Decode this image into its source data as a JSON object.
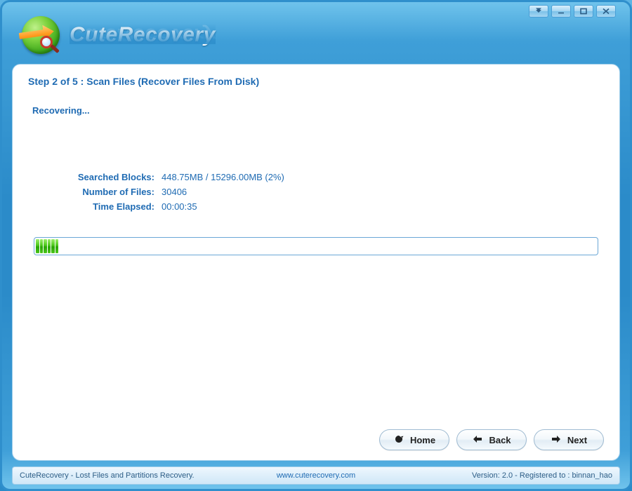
{
  "app": {
    "title": "CuteRecovery"
  },
  "step": {
    "heading": "Step 2 of 5 : Scan Files (Recover Files From Disk)",
    "status": "Recovering..."
  },
  "stats": {
    "searched_blocks_label": "Searched Blocks:",
    "searched_blocks_value": "448.75MB / 15296.00MB (2%)",
    "number_of_files_label": "Number of Files:",
    "number_of_files_value": "30406",
    "time_elapsed_label": "Time Elapsed:",
    "time_elapsed_value": "00:00:35"
  },
  "progress": {
    "percent": 2
  },
  "buttons": {
    "home": "Home",
    "back": "Back",
    "next": "Next"
  },
  "footer": {
    "left": "CuteRecovery - Lost Files and Partitions Recovery.",
    "link": "www.cuterecovery.com",
    "right": "Version: 2.0 - Registered to : binnan_hao"
  }
}
